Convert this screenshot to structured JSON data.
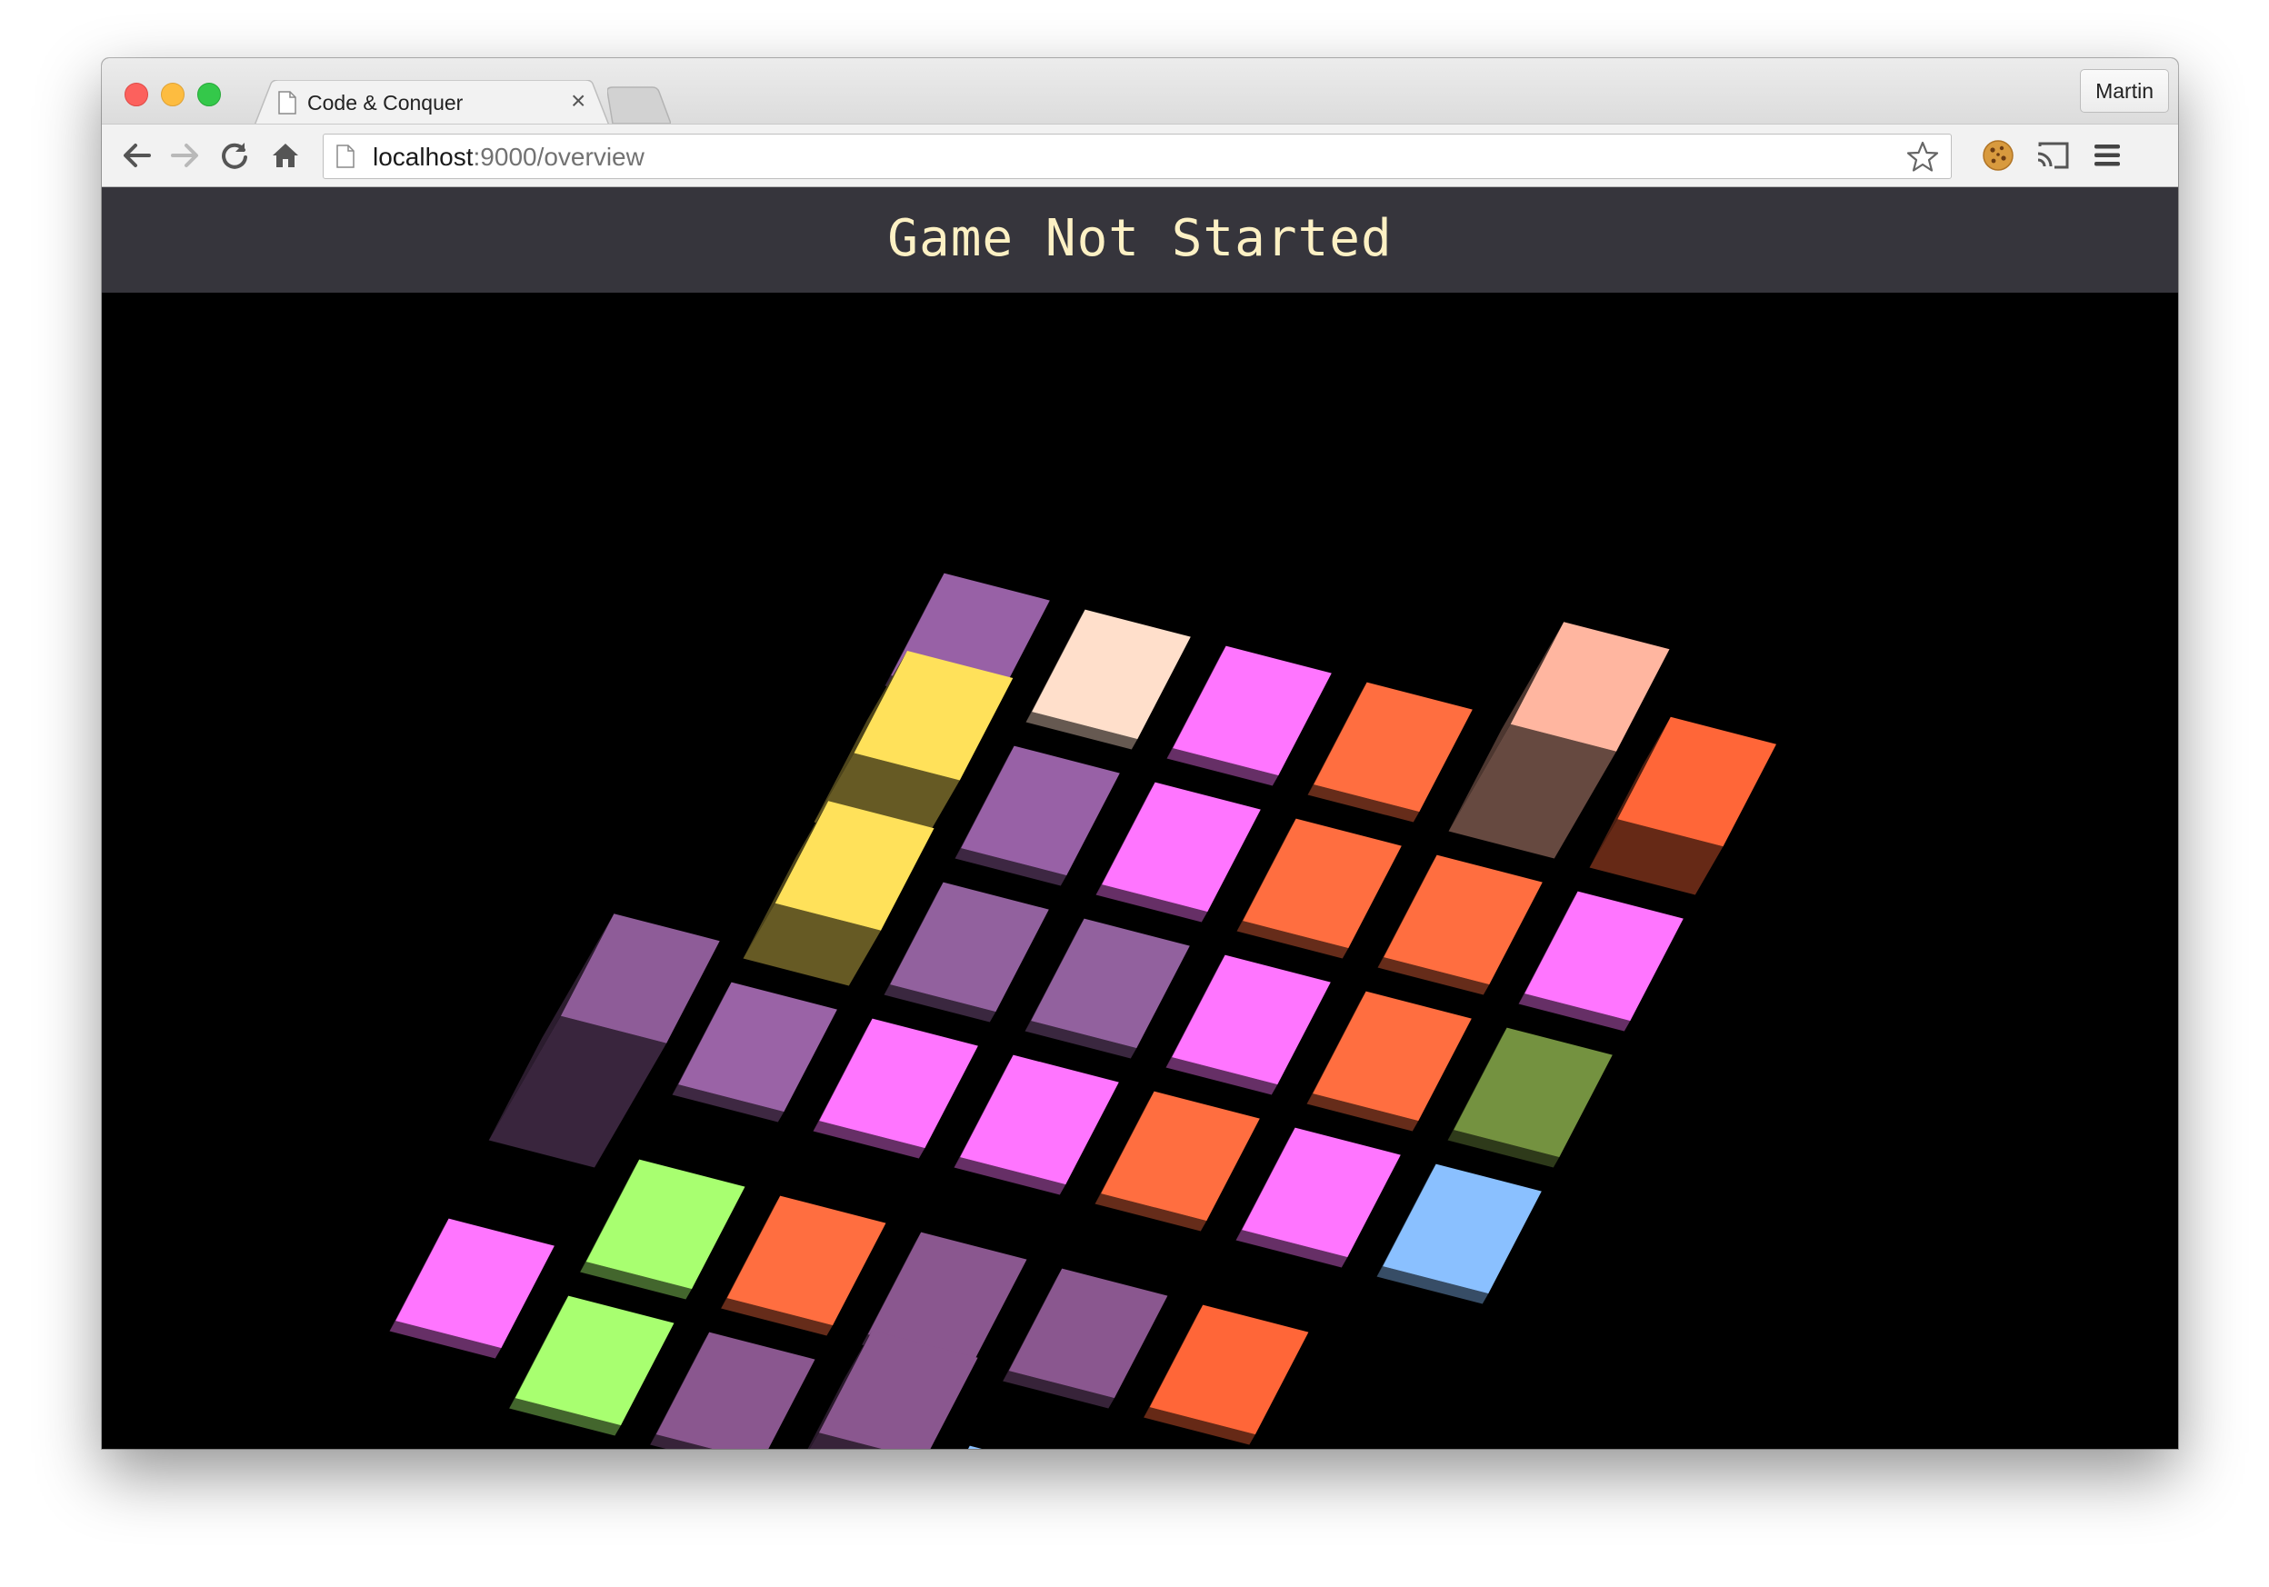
{
  "browser": {
    "tab_title": "Code & Conquer",
    "tab_close": "×",
    "profile": "Martin",
    "url_host": "localhost",
    "url_rest": ":9000/overview"
  },
  "page": {
    "title": "Game Not Started"
  },
  "colors": {
    "header_bg": "#36353c",
    "title_text": "#fdf1c4",
    "canvas_bg": "#000000"
  },
  "board": {
    "cells": [
      {
        "col": 0,
        "row": 0,
        "color": "#9861a6",
        "height": 0.3
      },
      {
        "col": 1,
        "row": 0,
        "color": "#ffdfcb",
        "height": 0.3
      },
      {
        "col": 2,
        "row": 0,
        "color": "#ff75ff",
        "height": 0.3
      },
      {
        "col": 3,
        "row": 0,
        "color": "#ff6e40",
        "height": 0.3
      },
      {
        "col": 4,
        "row": 0,
        "color": "#ffb6a0",
        "height": 3.1
      },
      {
        "col": 5,
        "row": 0,
        "color": "#ff6638",
        "height": 1.4
      },
      {
        "col": 0,
        "row": 1,
        "color": "#ffe15a",
        "height": 2.0
      },
      {
        "col": 1,
        "row": 1,
        "color": "#9861a6",
        "height": 0.3
      },
      {
        "col": 2,
        "row": 1,
        "color": "#ff75ff",
        "height": 0.3
      },
      {
        "col": 3,
        "row": 1,
        "color": "#ff6e40",
        "height": 0.3
      },
      {
        "col": 4,
        "row": 1,
        "color": "#ff6e40",
        "height": 0.3
      },
      {
        "col": 5,
        "row": 1,
        "color": "#ff75ff",
        "height": 0.3
      },
      {
        "col": 0,
        "row": 2,
        "color": "#ffe15a",
        "height": 1.6
      },
      {
        "col": 1,
        "row": 2,
        "color": "#92619e",
        "height": 0.3
      },
      {
        "col": 2,
        "row": 2,
        "color": "#92619e",
        "height": 0.3
      },
      {
        "col": 3,
        "row": 2,
        "color": "#ff75ff",
        "height": 0.3
      },
      {
        "col": 4,
        "row": 2,
        "color": "#ff6e40",
        "height": 0.3
      },
      {
        "col": 5,
        "row": 2,
        "color": "#749240",
        "height": 0.3
      },
      {
        "col": 0,
        "row": 3,
        "color": "#9a63a6",
        "height": 0.3
      },
      {
        "col": 1,
        "row": 3,
        "color": "#ff75ff",
        "height": 0.3
      },
      {
        "col": 2,
        "row": 3,
        "color": "#ff75ff",
        "height": 0.3
      },
      {
        "col": 3,
        "row": 3,
        "color": "#ff6e40",
        "height": 0.3
      },
      {
        "col": 4,
        "row": 3,
        "color": "#ff75ff",
        "height": 0.3
      },
      {
        "col": 5,
        "row": 3,
        "color": "#8ac0ff",
        "height": 0.3
      },
      {
        "col": -1,
        "row": 3.6,
        "color": "#8e5c98",
        "height": 3.6
      },
      {
        "col": 0,
        "row": 4.3,
        "color": "#a8ff70",
        "height": 0.3
      },
      {
        "col": 1,
        "row": 4.3,
        "color": "#ff6e40",
        "height": 0.3
      },
      {
        "col": 2,
        "row": 4.3,
        "color": "#8a578f",
        "height": 0.3
      },
      {
        "col": 3,
        "row": 4.3,
        "color": "#8a578f",
        "height": 0.3
      },
      {
        "col": 4,
        "row": 4.3,
        "color": "#ff6638",
        "height": 0.3
      },
      {
        "col": -1,
        "row": 5.0,
        "color": "#ff75ff",
        "height": 0.3
      },
      {
        "col": 0,
        "row": 5.3,
        "color": "#a8ff70",
        "height": 0.3
      },
      {
        "col": 1,
        "row": 5.3,
        "color": "#8a578f",
        "height": 0.3
      },
      {
        "col": 2,
        "row": 5.3,
        "color": "#8a578f",
        "height": 1.4
      },
      {
        "col": 3,
        "row": 5.6,
        "color": "#8ac0ff",
        "height": 0.3
      },
      {
        "col": 4,
        "row": 5.6,
        "color": "#ff75ff",
        "height": 0.3
      }
    ]
  }
}
